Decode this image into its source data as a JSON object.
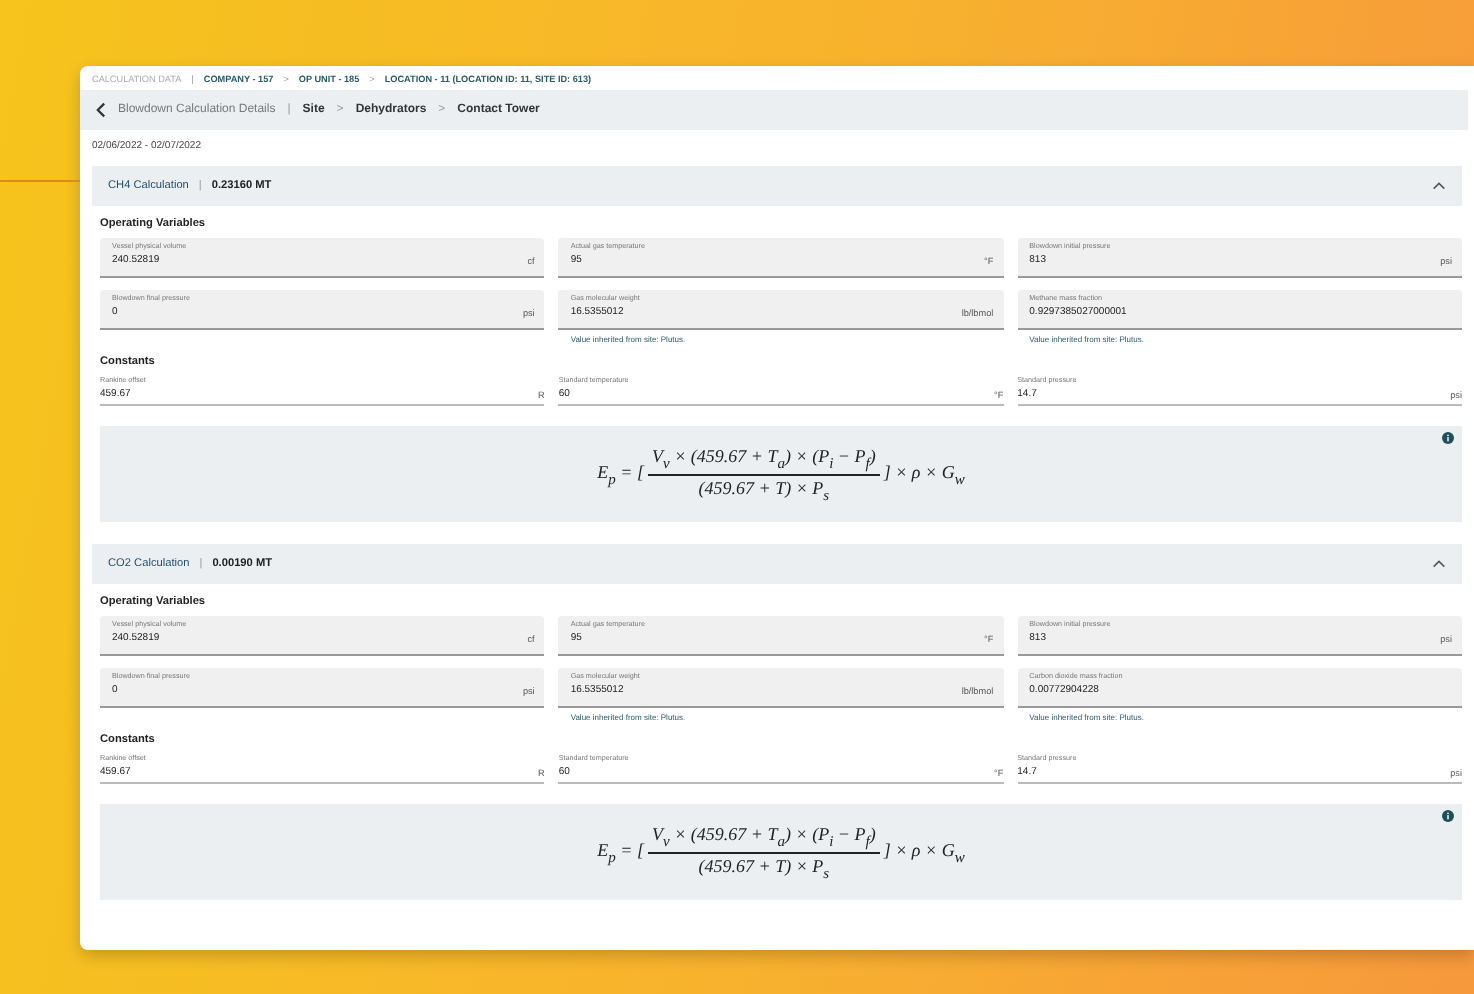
{
  "breadcrumb": [
    {
      "text": "CALCULATION DATA",
      "kind": "root"
    },
    {
      "separator": "|",
      "text": "COMPANY - 157",
      "kind": "item"
    },
    {
      "separator": ">",
      "text": "OP UNIT - 185",
      "kind": "item"
    },
    {
      "separator": ">",
      "text": "LOCATION - 11 (LOCATION ID: 11, SITE ID: 613)",
      "kind": "item"
    }
  ],
  "header": {
    "title": "Blowdown Calculation Details",
    "divider": "|",
    "path": [
      {
        "text": "Site"
      },
      {
        "separator": ">",
        "text": "Dehydrators"
      },
      {
        "separator": ">",
        "text": "Contact Tower"
      }
    ]
  },
  "date_range": "02/06/2022 - 02/07/2022",
  "sections": [
    {
      "title": "CH4 Calculation",
      "divider": "|",
      "result": "0.23160 MT",
      "expanded": true,
      "groups": [
        {
          "heading": "Operating Variables",
          "kind": "filled",
          "fields": [
            {
              "label": "Vessel physical volume",
              "value": "240.52819",
              "unit": "cf"
            },
            {
              "label": "Actual gas temperature",
              "value": "95",
              "unit": "°F"
            },
            {
              "label": "Blowdown initial pressure",
              "value": "813",
              "unit": "psi"
            },
            {
              "label": "Blowdown final pressure",
              "value": "0",
              "unit": "psi"
            },
            {
              "label": "Gas molecular weight",
              "value": "16.5355012",
              "unit": "lb/lbmol",
              "hint": "Value inherited from site: Plutus."
            },
            {
              "label": "Methane mass fraction",
              "value": "0.9297385027000001",
              "hint": "Value inherited from site: Plutus."
            }
          ]
        },
        {
          "heading": "Constants",
          "kind": "underline",
          "fields": [
            {
              "label": "Rankine offset",
              "value": "459.67",
              "unit": "R"
            },
            {
              "label": "Standard temperature",
              "value": "60",
              "unit": "°F"
            },
            {
              "label": "Standard pressure",
              "value": "14.7",
              "unit": "psi"
            }
          ]
        }
      ],
      "formula": {
        "lhs": "E$_{p}$ = [",
        "numerator": "V$_{v}$ × (459.67 + T$_{a}$) × (P$_{i}$ − P$_{f}$)",
        "denominator": "(459.67 + T) × P$_{s}$",
        "rhs": "] × ρ × G$_{w}$"
      }
    },
    {
      "title": "CO2 Calculation",
      "divider": "|",
      "result": "0.00190 MT",
      "expanded": true,
      "groups": [
        {
          "heading": "Operating Variables",
          "kind": "filled",
          "fields": [
            {
              "label": "Vessel physical volume",
              "value": "240.52819",
              "unit": "cf"
            },
            {
              "label": "Actual gas temperature",
              "value": "95",
              "unit": "°F"
            },
            {
              "label": "Blowdown initial pressure",
              "value": "813",
              "unit": "psi"
            },
            {
              "label": "Blowdown final pressure",
              "value": "0",
              "unit": "psi"
            },
            {
              "label": "Gas molecular weight",
              "value": "16.5355012",
              "unit": "lb/lbmol",
              "hint": "Value inherited from site: Plutus."
            },
            {
              "label": "Carbon dioxide mass fraction",
              "value": "0.00772904228",
              "hint": "Value inherited from site: Plutus."
            }
          ]
        },
        {
          "heading": "Constants",
          "kind": "underline",
          "fields": [
            {
              "label": "Rankine offset",
              "value": "459.67",
              "unit": "R"
            },
            {
              "label": "Standard temperature",
              "value": "60",
              "unit": "°F"
            },
            {
              "label": "Standard pressure",
              "value": "14.7",
              "unit": "psi"
            }
          ]
        }
      ],
      "formula": {
        "lhs": "E$_{p}$ = [",
        "numerator": "V$_{v}$ × (459.67 + T$_{a}$) × (P$_{i}$ − P$_{f}$)",
        "denominator": "(459.67 + T) × P$_{s}$",
        "rhs": "] × ρ × G$_{w}$"
      }
    }
  ]
}
